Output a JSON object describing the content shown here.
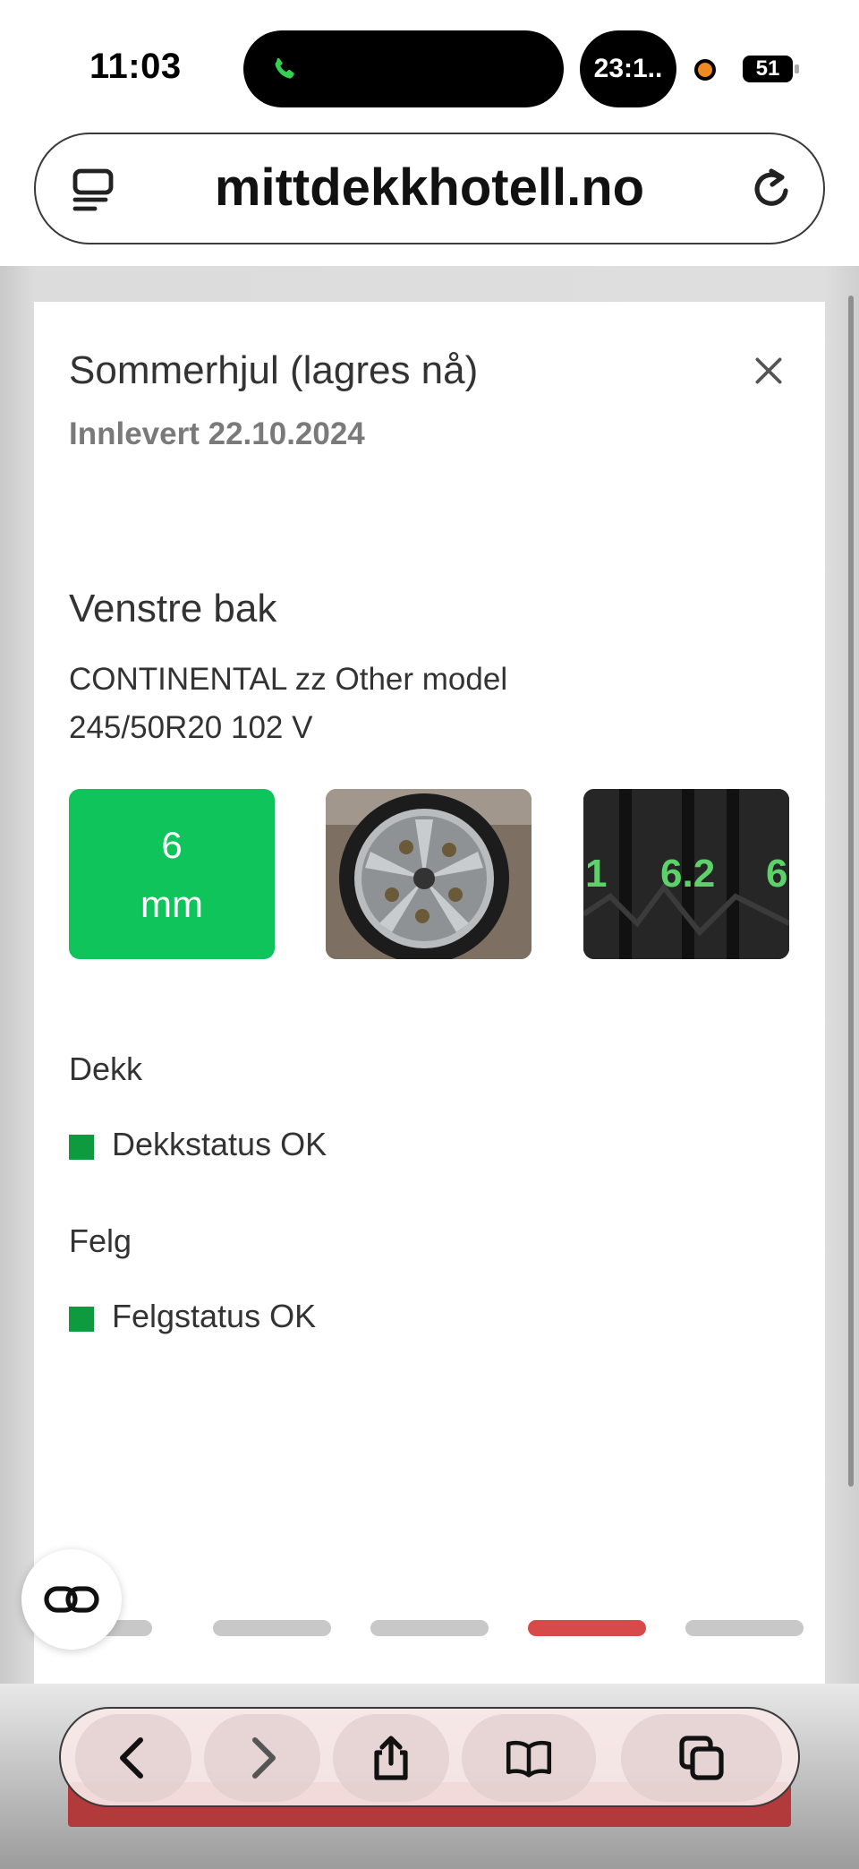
{
  "status_bar": {
    "time": "11:03",
    "timer": "23:1..",
    "battery": "51"
  },
  "browser": {
    "url": "mittdekkhotell.no"
  },
  "card": {
    "title": "Sommerhjul (lagres nå)",
    "subtitle": "Innlevert 22.10.2024",
    "wheel_position": "Venstre bak",
    "tire_brand_model": "CONTINENTAL zz Other model",
    "tire_size": "245/50R20 102 V",
    "tread_depth_value": "6",
    "tread_depth_unit": "mm",
    "tread_photo_readings": [
      "1",
      "6.2",
      "6"
    ],
    "sections": [
      {
        "label": "Dekk",
        "status": "Dekkstatus OK"
      },
      {
        "label": "Felg",
        "status": "Felgstatus OK"
      }
    ],
    "pagination": {
      "count": 5,
      "active_index": 3
    }
  },
  "colors": {
    "depth_ok": "#0fc45a",
    "status_ok": "#0e9a3e",
    "active_dot": "#d84a4a",
    "inactive_dot": "#c8c8c8"
  },
  "icons": {
    "call": "phone-icon",
    "tabs": "tabs-icon",
    "reload": "reload-icon",
    "close": "close-icon",
    "reader": "reader-icon",
    "back": "back-icon",
    "forward": "forward-icon",
    "share": "share-icon",
    "bookmarks": "bookmarks-icon",
    "tab_switch": "tab-switch-icon"
  }
}
